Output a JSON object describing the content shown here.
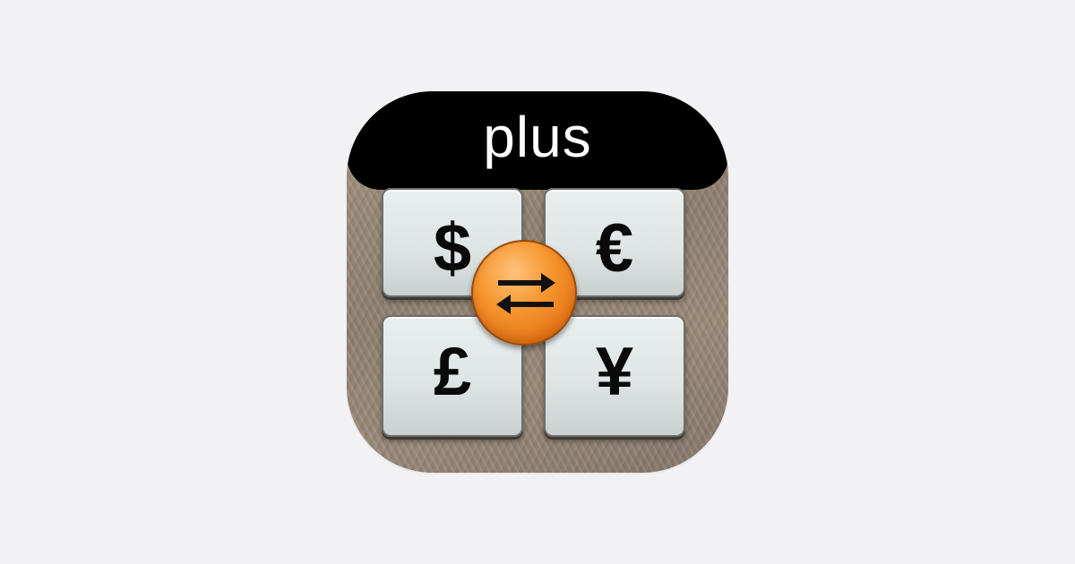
{
  "banner": {
    "label": "plus"
  },
  "keys": [
    {
      "symbol": "$",
      "icon": "dollar-key"
    },
    {
      "symbol": "€",
      "icon": "euro-key"
    },
    {
      "symbol": "£",
      "icon": "pound-key"
    },
    {
      "symbol": "¥",
      "icon": "yen-key"
    }
  ],
  "swap": {
    "icon": "swap-arrows-icon"
  },
  "colors": {
    "background": "#f2f2f4",
    "banner": "#000000",
    "banner_text": "#ffffff",
    "swap_button": "#f6962e",
    "key_face": "#e3e8e8"
  }
}
